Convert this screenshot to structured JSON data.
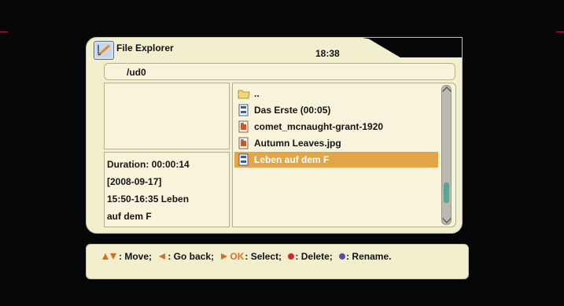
{
  "window": {
    "title": "File Explorer",
    "time": "18:38"
  },
  "path": {
    "current": "/ud0"
  },
  "info": {
    "lines": [
      "Duration: 00:00:14",
      "[2008-09-17]",
      "15:50-16:35 Leben",
      "auf dem F"
    ]
  },
  "files": [
    {
      "label": "..",
      "type": "folder",
      "icon": "folder-icon",
      "selected": false
    },
    {
      "label": "Das Erste (00:05)",
      "type": "recording",
      "icon": "video-file-icon",
      "selected": false
    },
    {
      "label": "comet_mcnaught-grant-1920",
      "type": "image",
      "icon": "image-file-icon",
      "selected": false
    },
    {
      "label": "Autumn Leaves.jpg",
      "type": "image",
      "icon": "image-file-icon",
      "selected": false
    },
    {
      "label": "Leben auf dem F",
      "type": "recording",
      "icon": "video-file-icon",
      "selected": true
    }
  ],
  "scrollbar": {
    "position_fraction": 0.92
  },
  "help": {
    "move": ": Move;",
    "back": ": Go back;",
    "ok_key": "OK",
    "select": ": Select;",
    "delete": ": Delete;",
    "rename": ": Rename.",
    "colors": {
      "arrow": "#d96b2a",
      "ok": "#d4752a",
      "delete_dot": "#cf2a28",
      "rename_dot": "#5a4ea3"
    }
  },
  "colors": {
    "panel_bg": "#f2efce",
    "selection": "#e2a548"
  }
}
